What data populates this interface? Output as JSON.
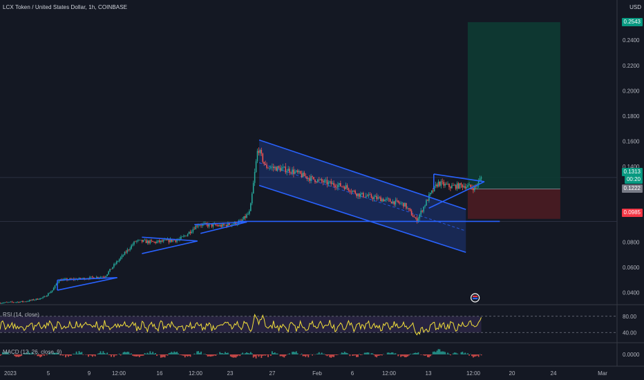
{
  "header": {
    "title": "LCX Token / United States Dollar, 1h, COINBASE"
  },
  "currency": "USD",
  "indicators": {
    "rsi_label": "RSI (14, close)",
    "macd_label": "MACD (12, 26, close, 9)"
  },
  "badges": {
    "target": "0.2543",
    "current": "0.1313",
    "countdown": "00:20",
    "entry": "0.1222",
    "stop": "0.0985"
  },
  "colors": {
    "background": "#141823",
    "candle_up": "#26a69a",
    "candle_down": "#ef5350",
    "drawing": "#2962ff",
    "rsi_line": "#f5e23b",
    "target_zone": "#0d3b33",
    "stop_zone": "#4a1c22",
    "stop_badge": "#f23645",
    "target_badge": "#089981"
  },
  "chart_data": {
    "type": "candlestick",
    "title": "LCX Token / United States Dollar, 1h, COINBASE",
    "x_ticks": [
      "2023",
      "5",
      "9",
      "12:00",
      "16",
      "12:00",
      "23",
      "27",
      "Feb",
      "6",
      "12:00",
      "13",
      "12:00",
      "20",
      "24",
      "Mar"
    ],
    "y_ticks": [
      "0.2400",
      "0.2200",
      "0.2000",
      "0.1800",
      "0.1600",
      "0.1400",
      "0.0800",
      "0.0600",
      "0.0400"
    ],
    "ylim": [
      0.03,
      0.262
    ],
    "price_path": [
      {
        "t": 0,
        "p": 0.032
      },
      {
        "t": 0.04,
        "p": 0.033
      },
      {
        "t": 0.07,
        "p": 0.036
      },
      {
        "t": 0.085,
        "p": 0.042
      },
      {
        "t": 0.095,
        "p": 0.05
      },
      {
        "t": 0.13,
        "p": 0.051
      },
      {
        "t": 0.17,
        "p": 0.053
      },
      {
        "t": 0.185,
        "p": 0.062
      },
      {
        "t": 0.2,
        "p": 0.07
      },
      {
        "t": 0.22,
        "p": 0.081
      },
      {
        "t": 0.25,
        "p": 0.08
      },
      {
        "t": 0.29,
        "p": 0.082
      },
      {
        "t": 0.3,
        "p": 0.085
      },
      {
        "t": 0.32,
        "p": 0.094
      },
      {
        "t": 0.36,
        "p": 0.093
      },
      {
        "t": 0.39,
        "p": 0.096
      },
      {
        "t": 0.405,
        "p": 0.104
      },
      {
        "t": 0.418,
        "p": 0.155
      },
      {
        "t": 0.43,
        "p": 0.14
      },
      {
        "t": 0.47,
        "p": 0.137
      },
      {
        "t": 0.5,
        "p": 0.131
      },
      {
        "t": 0.53,
        "p": 0.127
      },
      {
        "t": 0.56,
        "p": 0.124
      },
      {
        "t": 0.58,
        "p": 0.118
      },
      {
        "t": 0.62,
        "p": 0.114
      },
      {
        "t": 0.655,
        "p": 0.11
      },
      {
        "t": 0.675,
        "p": 0.097
      },
      {
        "t": 0.695,
        "p": 0.116
      },
      {
        "t": 0.71,
        "p": 0.127
      },
      {
        "t": 0.73,
        "p": 0.124
      },
      {
        "t": 0.75,
        "p": 0.125
      },
      {
        "t": 0.77,
        "p": 0.123
      },
      {
        "t": 0.78,
        "p": 0.1313
      }
    ],
    "rsi": {
      "upper": 80,
      "lower": 40,
      "ticks": [
        "80.00",
        "40.00"
      ]
    },
    "macd": {
      "ticks": [
        "0.0000"
      ]
    },
    "position": {
      "entry": 0.1222,
      "target": 0.2543,
      "stop": 0.0985
    },
    "patterns": [
      {
        "kind": "triangle",
        "lines": [
          [
            [
              0.093,
              0.05
            ],
            [
              0.19,
              0.052
            ]
          ],
          [
            [
              0.093,
              0.042
            ],
            [
              0.19,
              0.052
            ]
          ],
          [
            [
              0.093,
              0.05
            ],
            [
              0.093,
              0.042
            ]
          ]
        ]
      },
      {
        "kind": "triangle",
        "lines": [
          [
            [
              0.23,
              0.084
            ],
            [
              0.32,
              0.081
            ]
          ],
          [
            [
              0.23,
              0.071
            ],
            [
              0.32,
              0.081
            ]
          ]
        ]
      },
      {
        "kind": "triangle",
        "lines": [
          [
            [
              0.315,
              0.094
            ],
            [
              0.4,
              0.096
            ]
          ],
          [
            [
              0.325,
              0.087
            ],
            [
              0.4,
              0.096
            ]
          ]
        ]
      },
      {
        "kind": "support",
        "lines": [
          [
            [
              0.385,
              0.0965
            ],
            [
              0.81,
              0.0965
            ]
          ]
        ]
      },
      {
        "kind": "channel",
        "lines": [
          [
            [
              0.42,
              0.161
            ],
            [
              0.755,
              0.106
            ]
          ],
          [
            [
              0.42,
              0.125
            ],
            [
              0.755,
              0.072
            ]
          ]
        ]
      },
      {
        "kind": "triangle",
        "lines": [
          [
            [
              0.703,
              0.134
            ],
            [
              0.785,
              0.128
            ]
          ],
          [
            [
              0.695,
              0.107
            ],
            [
              0.785,
              0.128
            ]
          ],
          [
            [
              0.703,
              0.134
            ],
            [
              0.703,
              0.122
            ]
          ]
        ]
      }
    ]
  }
}
